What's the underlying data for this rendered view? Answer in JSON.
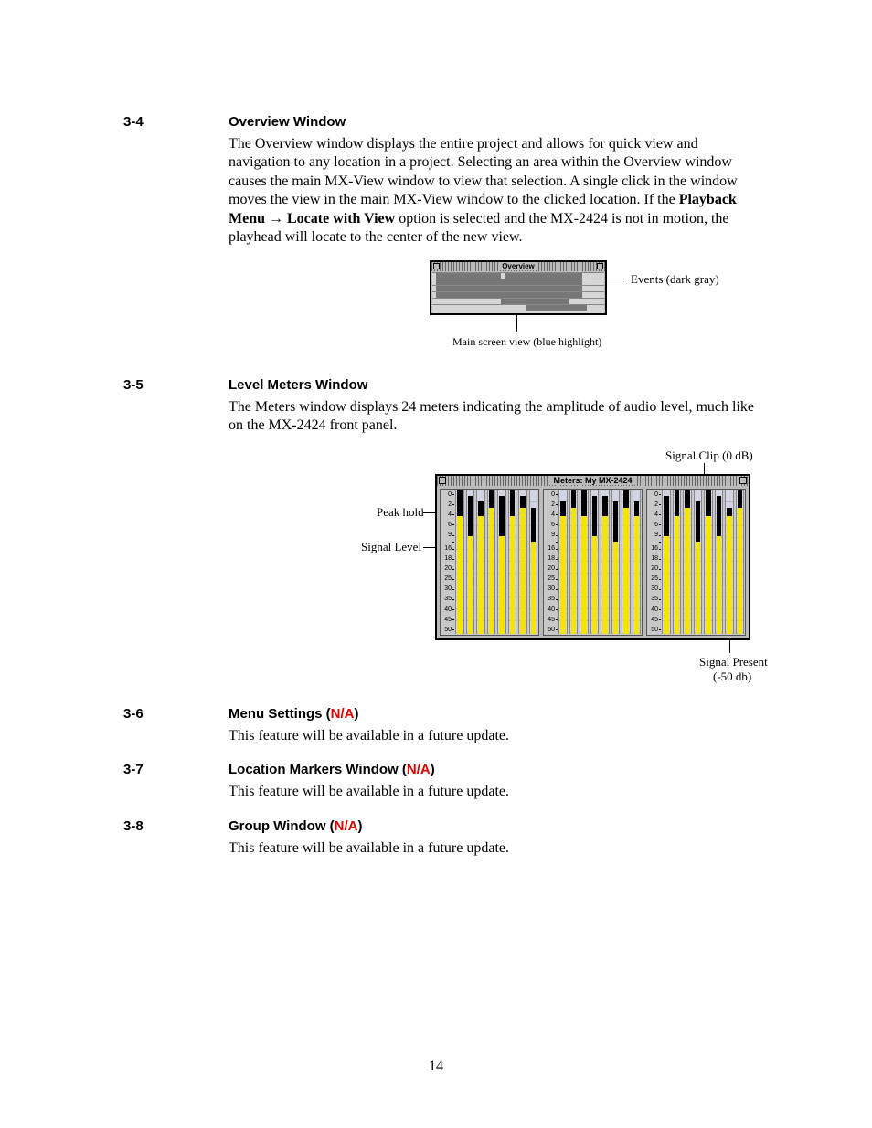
{
  "pageNumber": "14",
  "sections": {
    "s34": {
      "num": "3-4",
      "title": "Overview Window",
      "body_before": "The Overview window displays the entire project and allows for quick view and navigation to any location in a project. Selecting an area within the Overview window causes the main MX-View window to view that selection. A single click in the window moves the view in the main MX-View window to the clicked location. If the ",
      "bold1": "Playback Menu",
      "arrow": " → ",
      "bold2": "Locate with View",
      "body_after": " option is selected and the MX-2424 is not in motion, the playhead will locate to the center of the new view."
    },
    "overviewFigure": {
      "title": "Overview",
      "labelRight": "Events (dark gray)",
      "caption": "Main screen view (blue highlight)"
    },
    "s35": {
      "num": "3-5",
      "title": "Level Meters Window",
      "body": "The Meters window displays 24 meters indicating the amplitude of audio level, much like on the MX-2424 front panel."
    },
    "metersFigure": {
      "title": "Meters: My MX-2424",
      "labelTop": "Signal Clip (0 dB)",
      "labelPeak": "Peak hold",
      "labelSignal": "Signal Level",
      "labelBottom1": "Signal Present",
      "labelBottom2": "(-50 db)",
      "scale": [
        "0",
        "2",
        "4",
        "6",
        "9",
        "",
        "16",
        "18",
        "20",
        "25",
        "30",
        "35",
        "40",
        "45",
        "50"
      ]
    },
    "s36": {
      "num": "3-6",
      "title": "Menu Settings (",
      "na": "N/A",
      "titleEnd": ")",
      "body": "This feature will be available in a future update."
    },
    "s37": {
      "num": "3-7",
      "title": "Location Markers Window (",
      "na": "N/A",
      "titleEnd": ")",
      "body": "This feature will be available in a future update."
    },
    "s38": {
      "num": "3-8",
      "title": "Group Window (",
      "na": "N/A",
      "titleEnd": ")",
      "body": "This feature will be available in a future update."
    }
  },
  "chart_data": {
    "type": "bar",
    "title": "Meters: My MX-2424",
    "ylabel": "dB",
    "ylim": [
      -50,
      0
    ],
    "scale_ticks_db": [
      0,
      -2,
      -4,
      -6,
      -9,
      -16,
      -18,
      -20,
      -25,
      -30,
      -35,
      -40,
      -45,
      -50
    ],
    "channels": 24,
    "groups": 3,
    "peak_hold_db": [
      0,
      -2,
      -4,
      0,
      -2,
      0,
      -2,
      -6,
      -4,
      0,
      0,
      -2,
      -2,
      -4,
      0,
      -4,
      -2,
      0,
      0,
      -4,
      0,
      -2,
      -6,
      0
    ],
    "signal_level_db": [
      -9,
      -16,
      -9,
      -6,
      -16,
      -9,
      -6,
      -18,
      -9,
      -6,
      -9,
      -16,
      -9,
      -18,
      -6,
      -9,
      -16,
      -9,
      -6,
      -18,
      -9,
      -16,
      -9,
      -6
    ],
    "annotations": [
      "Peak hold",
      "Signal Level",
      "Signal Clip (0 dB)",
      "Signal Present (-50 db)"
    ]
  }
}
